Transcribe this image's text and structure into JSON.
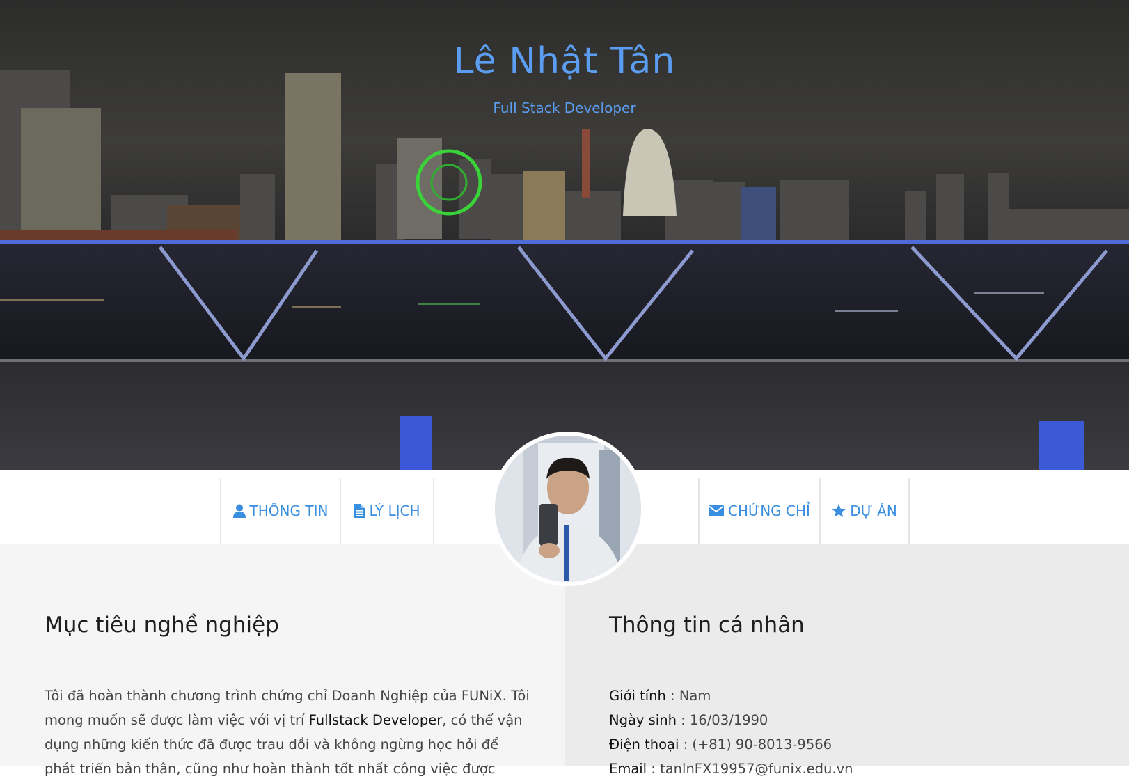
{
  "hero": {
    "name": "Lê Nhật Tân",
    "role": "Full Stack Developer"
  },
  "nav": {
    "items": [
      {
        "label": "THÔNG TIN",
        "icon": "user-icon"
      },
      {
        "label": "LÝ LỊCH",
        "icon": "file-icon"
      },
      {
        "label": "CHỨNG CHỈ",
        "icon": "envelope-icon"
      },
      {
        "label": "DỰ ÁN",
        "icon": "star-icon"
      }
    ]
  },
  "career": {
    "title": "Mục tiêu nghề nghiệp",
    "p1": "Tôi đã hoàn thành chương trình chứng chỉ Doanh Nghiệp của FUNiX. Tôi mong muốn sẽ được làm việc với vị trí ",
    "highlight": "Fullstack Developer",
    "p2": ", có thể vận dụng những kiến thức đã được trau dồi và không ngừng học hỏi để phát triển bản thân, cũng như hoàn thành tốt nhất công việc được"
  },
  "personal": {
    "title": "Thông tin cá nhân",
    "items": [
      {
        "key": "Giới tính",
        "value": "Nam"
      },
      {
        "key": "Ngày sinh",
        "value": "16/03/1990"
      },
      {
        "key": "Điện thoại",
        "value": "(+81) 90-8013-9566"
      },
      {
        "key": "Email",
        "value": "tanlnFX19957@funix.edu.vn"
      }
    ]
  },
  "colors": {
    "accent": "#3a8ee0",
    "hero_text": "#5b9df0",
    "left_bg": "#f5f5f5",
    "right_bg": "#ebebeb"
  }
}
